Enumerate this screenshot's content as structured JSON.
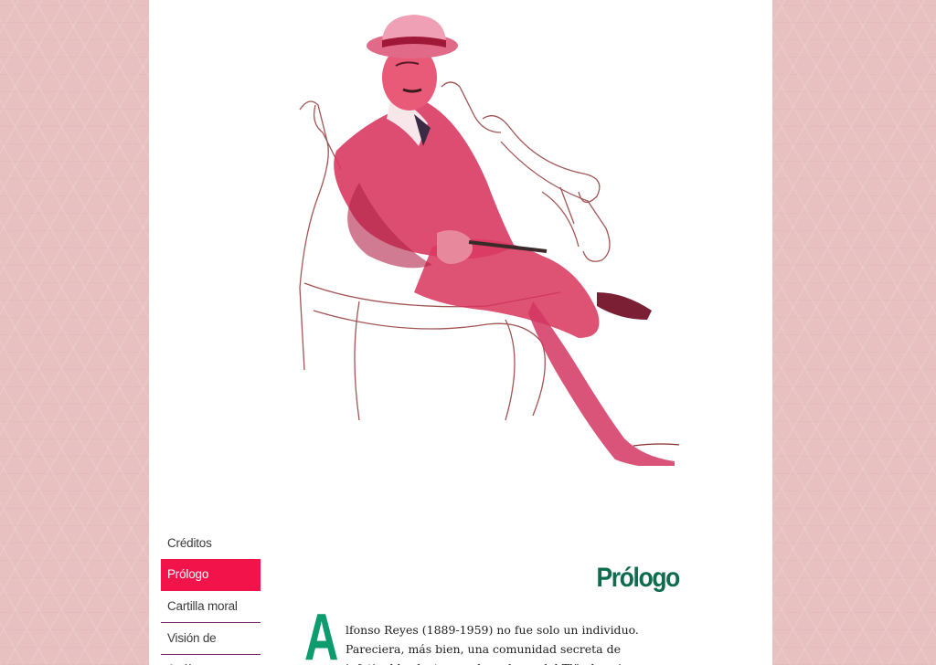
{
  "nav": {
    "items": [
      "Créditos",
      "Prólogo",
      "Cartilla moral",
      "Visión de Anáhuac"
    ],
    "active": "Prólogo"
  },
  "article": {
    "title": "Prólogo",
    "dropcap": "A",
    "body": "lfonso Reyes (1889-1959) no fue solo un individuo. Pareciera, más bien, una comunidad secreta de infatigables lectores y hacedores del Tlön borgiano, escondidos tras su único nombre."
  },
  "illustration": {
    "icon": "portrait-illustration-icon"
  },
  "colors": {
    "background": "#e8c0c0",
    "accent": "#f2134a",
    "title": "#0d6b4e",
    "dropcap": "#0e9b6e",
    "nav_divider": "#7a2a6a"
  }
}
